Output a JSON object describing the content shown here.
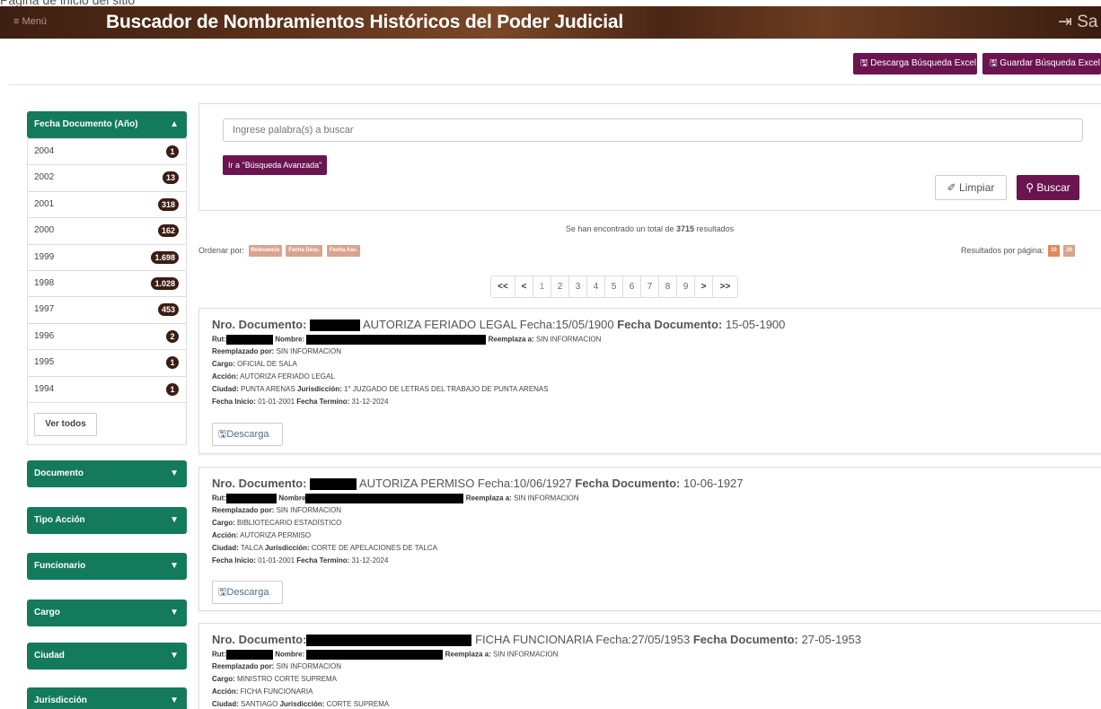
{
  "header": {
    "top_strip_text": "Página de inicio del sitio",
    "menu_label": "≡ Menú",
    "title": "Buscador de Nombramientos Históricos del Poder Judicial",
    "logout_label": "⇥ Sa"
  },
  "toolbar": {
    "excel_download_label": "🖫  Descarga Búsqueda Excel",
    "save_search_label": "🖫  Guardar Búsqueda Excel"
  },
  "facets": {
    "year": {
      "title": "Fecha Documento (Año)",
      "items": [
        {
          "label": "2004",
          "count": "1"
        },
        {
          "label": "2002",
          "count": "13"
        },
        {
          "label": "2001",
          "count": "318"
        },
        {
          "label": "2000",
          "count": "162"
        },
        {
          "label": "1999",
          "count": "1.698"
        },
        {
          "label": "1998",
          "count": "1.028"
        },
        {
          "label": "1997",
          "count": "453"
        },
        {
          "label": "1996",
          "count": "2"
        },
        {
          "label": "1995",
          "count": "1"
        },
        {
          "label": "1994",
          "count": "1"
        }
      ],
      "see_all_label": "Ver todos"
    },
    "collapsed": [
      {
        "title": "Documento"
      },
      {
        "title": "Tipo Acción"
      },
      {
        "title": "Funcionario"
      },
      {
        "title": "Cargo"
      },
      {
        "title": "Ciudad"
      },
      {
        "title": "Jurisdicción"
      }
    ]
  },
  "search": {
    "placeholder": "Ingrese palabra(s) a buscar",
    "advanced_label": "Ir a \"Búsqueda Avanzada\"",
    "clear_label": "Limpiar",
    "search_label": "Buscar"
  },
  "results_summary": {
    "prefix": "Se han encontrado un total de",
    "total": "3715",
    "suffix": "resultados"
  },
  "ordering": {
    "label": "Ordenar por:",
    "options": [
      "Relevancia",
      "Fecha Desc.",
      "Fecha Asc."
    ],
    "per_page_label": "Resultados por página:",
    "per_page_options": [
      "10",
      "20"
    ]
  },
  "pagination": {
    "first": "<<",
    "prev": "<",
    "pages": [
      "1",
      "2",
      "3",
      "4",
      "5",
      "6",
      "7",
      "8",
      "9"
    ],
    "current": "1",
    "next": ">",
    "last": ">>"
  },
  "results": [
    {
      "nro_label": "Nro. Documento:",
      "title_text": "AUTORIZA FERIADO LEGAL Fecha:15/05/1900",
      "fecha_doc_label": "Fecha Documento:",
      "fecha_doc": "15-05-1900",
      "rut_label": "Rut:",
      "nombre_label": "Nombre:",
      "reemplaza_label": "Reemplaza a:",
      "reemplaza": "SIN INFORMACION",
      "reemplazado_label": "Reemplazado por:",
      "reemplazado": "SIN INFORMACION",
      "cargo_label": "Cargo:",
      "cargo": "OFICIAL DE SALA",
      "accion_label": "Acción:",
      "accion": "AUTORIZA FERIADO LEGAL",
      "ciudad_label": "Ciudad:",
      "ciudad": "PUNTA ARENAS",
      "jurisdiccion_label": "Jurisdicción:",
      "jurisdiccion": "1° JUZGADO DE LETRAS DEL TRABAJO DE PUNTA ARENAS",
      "inicio_label": "Fecha Inicio:",
      "inicio": "01-01-2001",
      "termino_label": "Fecha Termino:",
      "termino": "31-12-2024",
      "download_label": "Descarga"
    },
    {
      "nro_label": "Nro. Documento:",
      "title_text": "AUTORIZA PERMISO Fecha:10/06/1927",
      "fecha_doc_label": "Fecha Documento:",
      "fecha_doc": "10-06-1927",
      "rut_label": "Rut:",
      "nombre_label": "Nombre",
      "reemplaza_label": "Reemplaza a:",
      "reemplaza": "SIN INFORMACION",
      "reemplazado_label": "Reemplazado por:",
      "reemplazado": "SIN INFORMACION",
      "cargo_label": "Cargo:",
      "cargo": "BIBLIOTECARIO ESTADÍSTICO",
      "accion_label": "Acción:",
      "accion": "AUTORIZA PERMISO",
      "ciudad_label": "Ciudad:",
      "ciudad": "TALCA",
      "jurisdiccion_label": "Jurisdicción:",
      "jurisdiccion": "CORTE DE APELACIONES DE TALCA",
      "inicio_label": "Fecha Inicio:",
      "inicio": "01-01-2001",
      "termino_label": "Fecha Termino:",
      "termino": "31-12-2024",
      "download_label": "Descarga"
    },
    {
      "nro_label": "Nro. Documento:",
      "title_text": "FICHA FUNCIONARIA Fecha:27/05/1953",
      "fecha_doc_label": "Fecha Documento:",
      "fecha_doc": "27-05-1953",
      "rut_label": "Rut:",
      "nombre_label": "Nombre:",
      "reemplaza_label": "Reemplaza a:",
      "reemplaza": "SIN INFORMACION",
      "reemplazado_label": "Reemplazado por:",
      "reemplazado": "SIN INFORMACION",
      "cargo_label": "Cargo:",
      "cargo": "MINISTRO CORTE SUPREMA",
      "accion_label": "Acción:",
      "accion": "FICHA FUNCIONARIA",
      "ciudad_label": "Ciudad:",
      "ciudad": "SANTIAGO",
      "jurisdiccion_label": "Jurisdicción:",
      "jurisdiccion": "CORTE SUPREMA"
    }
  ],
  "colors": {
    "header_brown": "#4b2615",
    "accent_purple": "#6b1450",
    "facet_green": "#137a5c",
    "badge_dark": "#3b1d14",
    "order_tag": "#d9a48f",
    "link_blue": "#4d6e8c"
  },
  "icons": {
    "menu": "hamburger-icon",
    "logout": "logout-icon",
    "save": "floppy-icon",
    "clear": "eraser-icon",
    "search": "search-icon",
    "expand": "chevron-down-icon",
    "collapse": "chevron-up-icon"
  }
}
